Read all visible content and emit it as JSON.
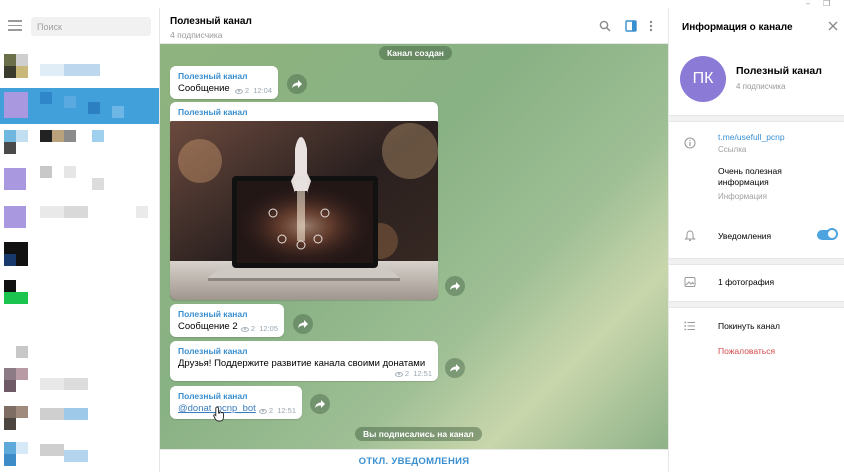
{
  "window": {
    "controls": [
      "–",
      "❐"
    ]
  },
  "sidebar": {
    "search": {
      "placeholder": "Поиск",
      "value": ""
    }
  },
  "chat": {
    "title": "Полезный канал",
    "subtitle": "4 подписчика",
    "service_created": "Канал создан",
    "service_subscribed": "Вы подписались на канал",
    "messages": [
      {
        "author": "Полезный канал",
        "text": "Сообщение",
        "views": "2",
        "time": "12:04"
      },
      {
        "author": "Полезный канал",
        "has_photo": true
      },
      {
        "author": "Полезный канал",
        "text": "Сообщение 2",
        "views": "2",
        "time": "12:05"
      },
      {
        "author": "Полезный канал",
        "text": "Друзья! Поддержите развитие канала своими донатами",
        "views": "2",
        "time": "12:51"
      },
      {
        "author": "Полезный канал",
        "link": "@donat_pcnp_bot",
        "views": "2",
        "time": "12:51"
      }
    ],
    "footer_button": "ОТКЛ. УВЕДОМЛЕНИЯ"
  },
  "info": {
    "title": "Информация о канале",
    "avatar_initials": "ПК",
    "avatar_color": "#8b7ad6",
    "name": "Полезный канал",
    "subscribers": "4 подписчика",
    "link": "t.me/usefull_pcnp",
    "link_label": "Ссылка",
    "description_line1": "Очень полезная",
    "description_line2": "информация",
    "description_label": "Информация",
    "notifications": "Уведомления",
    "notifications_enabled": true,
    "photos": "1 фотография",
    "leave": "Покинуть канал",
    "report": "Пожаловаться"
  },
  "colors": {
    "accent": "#3a8fd0",
    "danger": "#d34a4a",
    "active_chat": "#419fd9"
  }
}
